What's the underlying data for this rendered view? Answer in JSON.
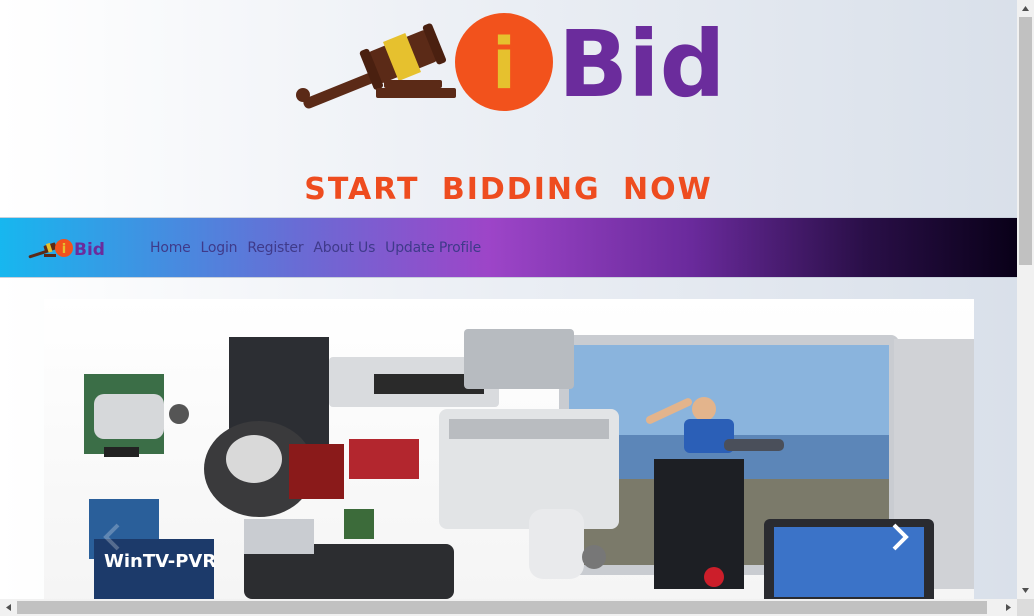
{
  "brand": {
    "name": "iBid",
    "logo_letter": "i",
    "logo_rest": "Bid"
  },
  "tagline": "START BIDDING NOW",
  "nav": {
    "items": [
      {
        "label": "Home"
      },
      {
        "label": "Login"
      },
      {
        "label": "Register"
      },
      {
        "label": "About Us"
      },
      {
        "label": "Update Profile"
      }
    ]
  },
  "carousel": {
    "image_icon": "electronics-product-collage",
    "next_icon": "chevron-right-icon",
    "prev_icon": "chevron-left-icon"
  },
  "colors": {
    "tagline": "#ee4c1f",
    "logo_orange": "#f2521c",
    "logo_purple": "#6b2c9c",
    "logo_gavel": "#5b2a17",
    "logo_band": "#e6c12e",
    "nav_link": "#3f3a8a"
  }
}
